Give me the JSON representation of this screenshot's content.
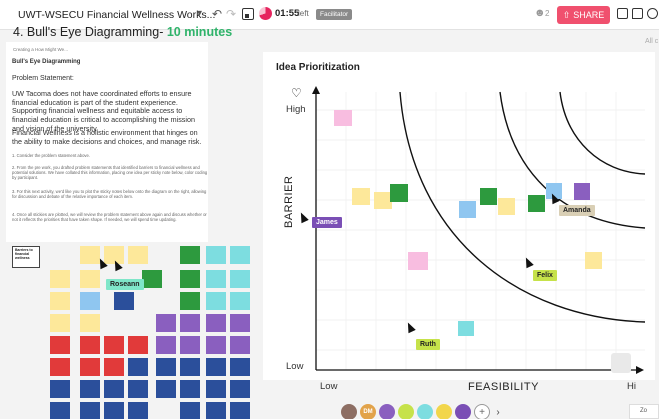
{
  "topbar": {
    "board_title": "UWT-WSECU Financial Wellness Works...",
    "timer": "01:55",
    "timer_suffix": "left",
    "facilitator": "Facilitator",
    "share_label": "SHARE",
    "user_count": "2"
  },
  "instructions": {
    "title": "4. Bull's Eye Diagramming-",
    "title_time": "10 minutes",
    "caption": "Creating a How Might We...",
    "heading": "Bull's Eye Diagramming",
    "problem_label": "Problem Statement:",
    "problem_text": "UW Tacoma does not have coordinated efforts to ensure financial education is part of the student experience. Supporting financial wellness and equitable access to financial education is critical to accomplishing the mission and vision of the university.",
    "wellness_text": "Financial Wellness is a holistic environment that hinges on the ability to make decisions and choices, and manage risk.",
    "steps": [
      "1. Consider the problem statement above.",
      "2. From the pre work, you drafted problem statements that identified barriers to financial wellness and potential solutions. We have collated this information, placing one idea per sticky note below, color coding by participant.",
      "3. For this next activity, we'd like you to plot the sticky notes below onto the diagram on the right, allowing for discussion and debate of the relative importance of each item.",
      "4. Once all stickies are plotted, we will review the problem statement above again and discuss whether or not it reflects the priorities that have taken shape. If needed, we will spend time updating."
    ],
    "barriers_card": "Barriers to financial wellness"
  },
  "prioritization": {
    "title": "Idea Prioritization",
    "y_axis_label": "BARRIER",
    "x_axis_label": "FEASIBILITY",
    "high_label": "High",
    "low_y_label": "Low",
    "low_x_label": "Low",
    "right_x_label": "Hi"
  },
  "collaborators": {
    "james": "James",
    "roseann": "Roseann",
    "amanda": "Amanda",
    "felix": "Felix",
    "ruth": "Ruth",
    "dm": "DM"
  },
  "side": {
    "all_label": "All c",
    "zoom_label": "Zo"
  },
  "colors": {
    "share": "#f0506e",
    "timer_green": "#2fb36a",
    "timer_ring": "#e6245e"
  }
}
